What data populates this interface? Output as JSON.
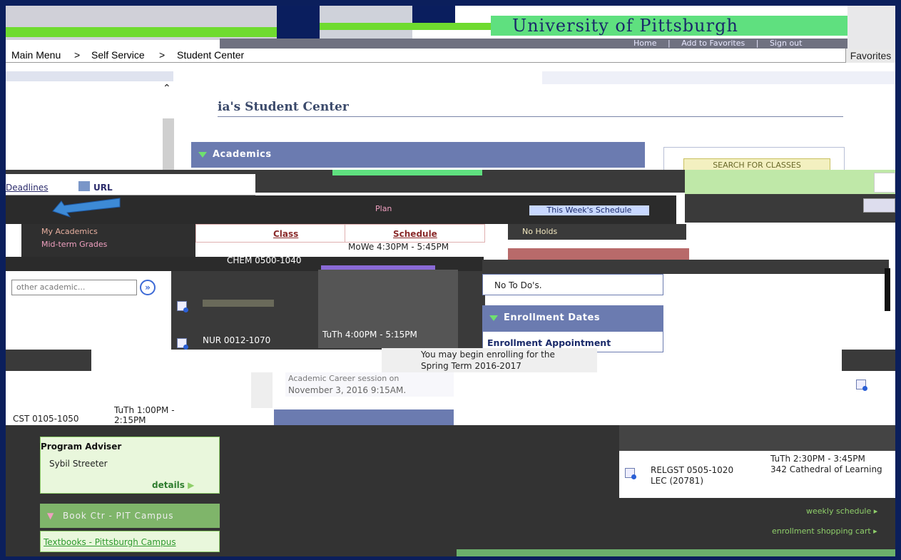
{
  "header": {
    "university_name": "University of Pittsburgh",
    "links": {
      "home": "Home",
      "add_to_favorites": "Add to Favorites",
      "sign_out": "Sign out"
    }
  },
  "breadcrumb": {
    "items": [
      "Main Menu",
      ">",
      "Self Service",
      ">",
      "Student Center"
    ]
  },
  "favorites_label": "Favorites",
  "page": {
    "title": "ia's Student Center"
  },
  "academics": {
    "header": "Academics"
  },
  "search_for_classes": "SEARCH FOR CLASSES",
  "left_nav": {
    "deadlines": "Deadlines",
    "url": "URL",
    "plan": "Plan",
    "items": [
      "My Academics",
      "Mid-term Grades"
    ],
    "select_placeholder": "other academic..."
  },
  "schedule_table": {
    "headers": [
      "Class",
      "Schedule"
    ],
    "rows": [
      {
        "class": "CHEM 0500-1040",
        "schedule": "MoWe 4:30PM - 5:45PM"
      },
      {
        "class": "NUR 0012-1070",
        "schedule": "TuTh 4:00PM - 5:15PM"
      },
      {
        "class": "CST 0105-1050",
        "schedule": "TuTh 1:00PM - 2:15PM"
      },
      {
        "class": "RELGST 0505-1020\nLEC (20781)",
        "schedule": "TuTh 2:30PM - 3:45PM\n342 Cathedral of Learning"
      }
    ]
  },
  "this_weeks_schedule": "This Week's Schedule",
  "holds": {
    "text": "No Holds"
  },
  "todo": {
    "text": "No To Do's."
  },
  "enrollment_dates": {
    "header": "Enrollment Dates",
    "appointment_label": "Enrollment Appointment",
    "message_line1": "You may begin enrolling for the",
    "message_line2": "Spring Term 2016-2017",
    "session_line": "Academic Career session on",
    "date_line": "November 3, 2016 9:15AM."
  },
  "advisor": {
    "label": "Program Adviser",
    "name": "Sybil Streeter",
    "details": "details"
  },
  "book_center": {
    "header": "Book Ctr - PIT Campus",
    "link": "Textbooks - Pittsburgh Campus"
  },
  "right_links": {
    "weekly_schedule": "weekly schedule",
    "shopping_cart": "enrollment shopping cart"
  },
  "colors": {
    "navy": "#0a1e5e",
    "header_blue": "#6b7bb0",
    "green": "#8fcf6a",
    "link_green": "#2f9a2f"
  }
}
